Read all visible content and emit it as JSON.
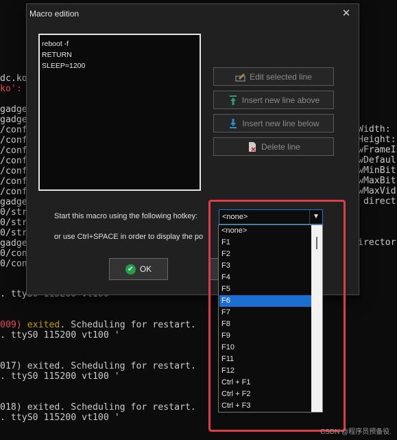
{
  "terminal": {
    "left_lines": [
      "dc.ko",
      "ko':",
      "gadge",
      "gadge",
      "/conf",
      "/conf",
      "/conf",
      "/conf",
      "/conf",
      "/conf",
      "/conf",
      "gadge",
      "0/str",
      "0/str",
      "0/str",
      "gadge",
      "0/con",
      "0/con"
    ],
    "right_lines": [
      "Width: (",
      "Height: ",
      "wFrameIn",
      "wDefaul",
      "wMinBit",
      "wMaxBit",
      "wMaxVid",
      " direct",
      "irector"
    ],
    "bottom_lines": [
      ". ttyS0 115200 vt100",
      "009) exited. Scheduling for restart.",
      ". ttyS0 115200 vt100 '",
      "017) exited. Scheduling for restart.",
      ". ttyS0 115200 vt100 '",
      "018) exited. Scheduling for restart.",
      ". ttyS0 115200 vt100 '"
    ]
  },
  "dialog": {
    "title": "Macro edition",
    "close_glyph": "✕",
    "macro_lines": [
      "reboot -f",
      "RETURN",
      "SLEEP=1200"
    ],
    "buttons": {
      "edit": "Edit selected line",
      "insert_above": "Insert new line above",
      "insert_below": "Insert new line below",
      "delete": "Delete line",
      "ok": "OK"
    },
    "hotkey_label": "Start this macro using the following hotkey:",
    "or_label": "or use Ctrl+SPACE in order to display the po",
    "hotkey_selected": "<none>"
  },
  "dropdown": {
    "options": [
      "<none>",
      "F1",
      "F2",
      "F3",
      "F4",
      "F5",
      "F6",
      "F7",
      "F8",
      "F9",
      "F10",
      "F11",
      "F12",
      "Ctrl + F1",
      "Ctrl + F2",
      "Ctrl + F3"
    ],
    "highlighted": "F6"
  },
  "icons": [
    "edit-line-icon",
    "insert-above-icon",
    "insert-below-icon",
    "delete-line-icon",
    "ok-check-icon",
    "chevron-down-icon",
    "close-icon"
  ],
  "colors": {
    "accent": "#1c6fd0",
    "annotation_box": "#e03c48",
    "ok_check": "#22a14a",
    "terminal_red": "#e74856",
    "terminal_yellow": "#c19c00"
  },
  "watermark": "CSDN @程序员预备役."
}
